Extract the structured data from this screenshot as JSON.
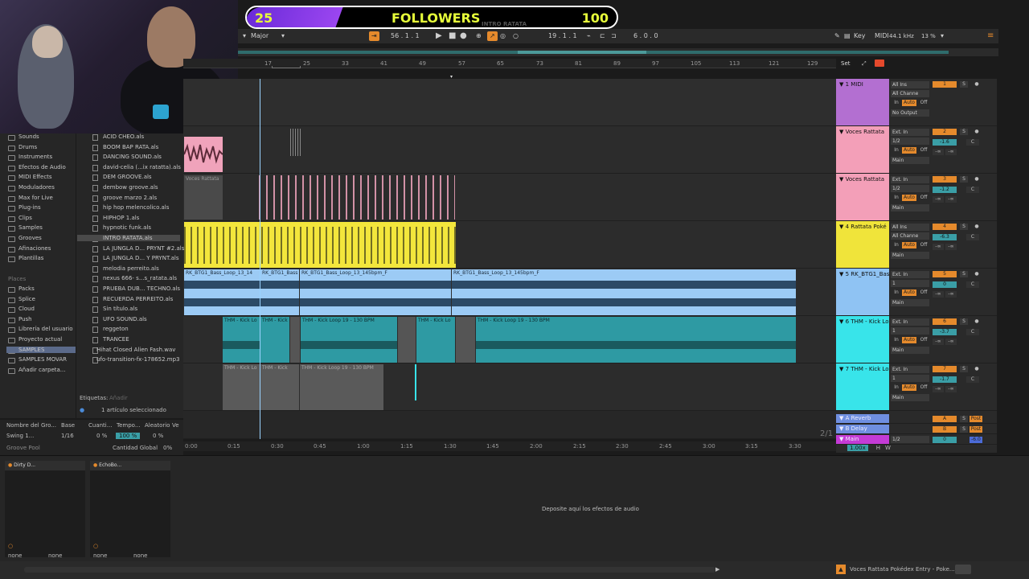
{
  "overlay": {
    "followers_count": "25",
    "followers_title": "FOLLOWERS",
    "followers_goal": "100",
    "followers_subtitle": "INTRO RATATA",
    "progress_fraction": 0.25
  },
  "transport": {
    "scale": "Major",
    "position": "56 .  1 .  1",
    "loop_start": "19 .  1 .  1",
    "loop_length": "6 .  0 .  0",
    "key_label": "Key",
    "midi_label": "MIDI",
    "sample_rate": "44.1 kHz",
    "cpu": "13 %"
  },
  "ruler_ticks": [
    "17",
    "25",
    "33",
    "41",
    "49",
    "57",
    "65",
    "73",
    "81",
    "89",
    "97",
    "105",
    "113",
    "121",
    "129"
  ],
  "time_ticks": [
    "0:00",
    "0:15",
    "0:30",
    "0:45",
    "1:00",
    "1:15",
    "1:30",
    "1:45",
    "2:00",
    "2:15",
    "2:30",
    "2:45",
    "3:00",
    "3:15",
    "3:30"
  ],
  "arrangement": {
    "clip_voces": "Voces Rattata",
    "clip_bass_a": "RK_BTG1_Bass_Loop_13_14",
    "clip_bass_b": "RK_BTG1_Bass",
    "clip_bass_c": "RK_BTG1_Bass_Loop_13_145bpm_F",
    "clip_bass_d": "RK_BTG1_Bass_Loop_13_145bpm_F",
    "clip_kick_a": "THM - Kick Lo",
    "clip_kick_b": "THM - Kick",
    "clip_kick_c": "THM - Kick Loop 19 - 130 BPM",
    "clip_kick_d": "THM - Kick Lo",
    "clip_kick_e": "THM - Kick Loop 19 - 130 BPM",
    "clip_kick_g": "THM - Kick Lo",
    "clip_kick_h": "THM - Kick",
    "clip_kick_i": "THM - Kick Loop 19 - 130 BPM",
    "page_indicator": "2/1"
  },
  "tracks": [
    {
      "name": "1 MIDI",
      "color": "#b36fd1",
      "input": "All Ins",
      "channel": "All Channe",
      "output": "No Output",
      "number": "1"
    },
    {
      "name": "Voces Rattata",
      "color": "#f39fb8",
      "input": "Ext. In",
      "channel": "1/2",
      "output": "Main",
      "number": "2",
      "vol": "-1.6"
    },
    {
      "name": "Voces Rattata",
      "color": "#f39fb8",
      "input": "Ext. In",
      "channel": "1/2",
      "output": "Main",
      "number": "3",
      "vol": "-1.2"
    },
    {
      "name": "4 Rattata Poké",
      "color": "#f0e43a",
      "input": "All Ins",
      "channel": "All Channe",
      "output": "Main",
      "number": "4",
      "vol": "-6.3"
    },
    {
      "name": "5 RK_BTG1_Bas",
      "color": "#8fc3f3",
      "input": "Ext. In",
      "channel": "1",
      "output": "Main",
      "number": "5",
      "vol": "0"
    },
    {
      "name": "6 THM - Kick Lo",
      "color": "#38e4ea",
      "input": "Ext. In",
      "channel": "1",
      "output": "Main",
      "number": "6",
      "vol": "-3.7"
    },
    {
      "name": "7 THM - Kick Lo",
      "color": "#38e4ea",
      "input": "Ext. In",
      "channel": "1",
      "output": "Main",
      "number": "7",
      "vol": "-1.7"
    }
  ],
  "returns": [
    {
      "name": "A Reverb",
      "letter": "A",
      "post": "Post"
    },
    {
      "name": "B Delay",
      "letter": "B",
      "post": "Post"
    },
    {
      "name": "Main",
      "letter": "0",
      "post": "-6.0",
      "channel": "1/2"
    }
  ],
  "track_header": {
    "set_label": "Set",
    "in_label": "In",
    "auto_label": "Auto",
    "off_label": "Off",
    "s_label": "S",
    "c_label": "C",
    "inf": "-∞",
    "zoom": "1.00x",
    "h_label": "H",
    "w_label": "W"
  },
  "browser": {
    "categories": [
      "Sounds",
      "Drums",
      "Instruments",
      "Efectos de Audio",
      "MIDI Effects",
      "Moduladores",
      "Max for Live",
      "Plug-ins",
      "Clips",
      "Samples",
      "Grooves",
      "Afinaciones",
      "Plantillas"
    ],
    "places_label": "Places",
    "places": [
      "Packs",
      "Splice",
      "Cloud",
      "Push",
      "Librería del usuario",
      "Proyecto actual",
      "SAMPLES",
      "SAMPLES MOVAR",
      "Añadir carpeta..."
    ],
    "files": [
      "ACID CHEO.als",
      "BOOM BAP RATA.als",
      "DANCING SOUND.als",
      "david-celia (...ix ratatta).als",
      "DEM GROOVE.als",
      "dembow groove.als",
      "groove marzo 2.als",
      "hip hop melencolico.als",
      "HIPHOP 1.als",
      "hypnotic funk.als",
      "INTRO RATATA.als",
      "LA JUNGLA D... PRYNT #2.als",
      "LA JUNGLA D... Y PRYNT.als",
      "melodia perreito.als",
      "nexus 666- s...s_ratata.als",
      "PRUEBA DUB... TECHNO.als",
      "RECUERDA PERREITO.als",
      "Sin título.als",
      "UFO SOUND.als",
      "reggeton",
      "TRANCEE",
      "Hihat Closed Alien Fash.wav",
      "ufo-transition-fx-178652.mp3"
    ],
    "tags_label": "Etiquetas:",
    "tags_add": "Añadir",
    "selection": "1 artículo seleccionado"
  },
  "groove": {
    "headers": [
      "Nombre del Gro...",
      "Base",
      "Cuanti...",
      "Tempo...",
      "Aleatorio",
      "Ve"
    ],
    "row_name": "Swing 1...",
    "row_base": "1/16",
    "row_quant": "0 %",
    "row_tempo": "100 %",
    "row_random": "0 %",
    "pool_label": "Groove Pool",
    "global_label": "Cantidad Global",
    "global_value": "0%"
  },
  "devices": {
    "device1": "Dirty D...",
    "device2": "EchoBo...",
    "none": "none",
    "drop_hint": "Deposite aquí los efectos de audio"
  },
  "status": {
    "current_track": "Voces Rattata Pokédex Entry - Poke..."
  }
}
